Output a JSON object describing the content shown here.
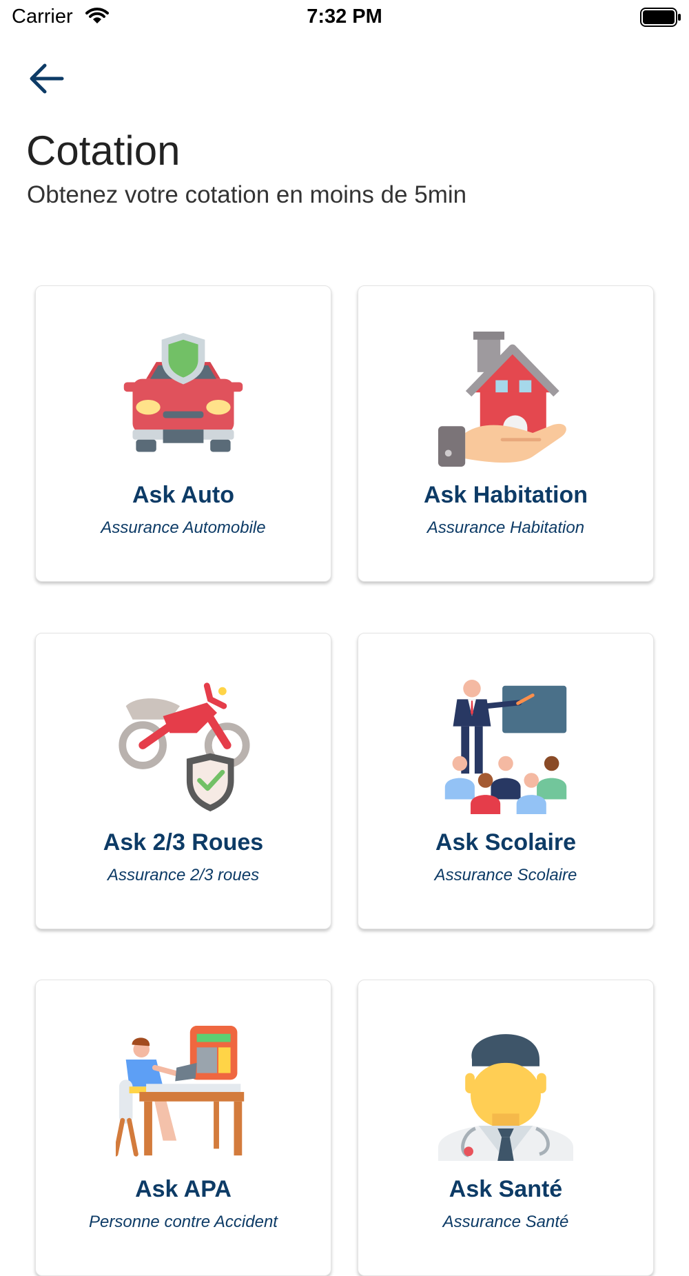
{
  "status_bar": {
    "carrier": "Carrier",
    "time": "7:32 PM"
  },
  "header": {
    "title": "Cotation",
    "subtitle": "Obtenez votre cotation en moins de 5min"
  },
  "cards": [
    {
      "title": "Ask Auto",
      "subtitle": "Assurance Automobile",
      "icon": "car-shield-icon"
    },
    {
      "title": "Ask Habitation",
      "subtitle": "Assurance Habitation",
      "icon": "house-hand-icon"
    },
    {
      "title": "Ask 2/3 Roues",
      "subtitle": "Assurance 2/3 roues",
      "icon": "motorbike-shield-icon"
    },
    {
      "title": "Ask Scolaire",
      "subtitle": "Assurance Scolaire",
      "icon": "classroom-icon"
    },
    {
      "title": "Ask APA",
      "subtitle": "Personne contre Accident",
      "icon": "desk-worker-icon"
    },
    {
      "title": "Ask Santé",
      "subtitle": "Assurance Santé",
      "icon": "doctor-icon"
    }
  ],
  "colors": {
    "accent": "#0d3b66",
    "card_border": "#e4e4e4"
  }
}
